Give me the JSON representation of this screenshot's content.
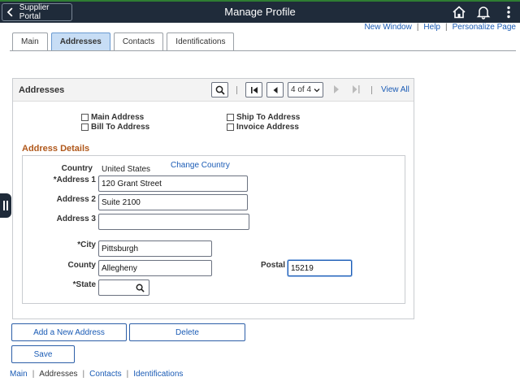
{
  "header": {
    "back_label": "Supplier Portal",
    "title": "Manage Profile",
    "icons": [
      "home-icon",
      "bell-icon",
      "more-vertical-icon"
    ]
  },
  "toplinks": {
    "new_window": "New Window",
    "help": "Help",
    "personalize": "Personalize Page",
    "separator": "|"
  },
  "tabs": [
    {
      "label": "Main",
      "active": false
    },
    {
      "label": "Addresses",
      "active": true
    },
    {
      "label": "Contacts",
      "active": false
    },
    {
      "label": "Identifications",
      "active": false
    }
  ],
  "panel": {
    "title": "Addresses",
    "row_selector": "4 of 4",
    "view_all": "View All"
  },
  "address_types": {
    "main": "Main Address",
    "bill_to": "Bill To Address",
    "ship_to": "Ship To Address",
    "invoice": "Invoice Address"
  },
  "details": {
    "title": "Address Details",
    "country_label": "Country",
    "country_value": "United States",
    "change_country": "Change Country",
    "address1_label": "Address 1",
    "address1_value": "120 Grant Street",
    "address2_label": "Address 2",
    "address2_value": "Suite 2100",
    "address3_label": "Address 3",
    "address3_value": "",
    "city_label": "City",
    "city_value": "Pittsburgh",
    "county_label": "County",
    "county_value": "Allegheny",
    "postal_label": "Postal",
    "postal_value": "15219",
    "state_label": "State",
    "state_value": "",
    "required_marker": "*"
  },
  "buttons": {
    "add_address": "Add a New Address",
    "delete": "Delete",
    "save": "Save"
  },
  "footer": {
    "main": "Main",
    "addresses": "Addresses",
    "contacts": "Contacts",
    "identifications": "Identifications",
    "separator": "|"
  },
  "colors": {
    "header_bg": "#1f2b3a",
    "accent_green": "#2e7d32",
    "link": "#1a5bb5",
    "active_tab": "#c7ddf5",
    "section_title": "#b0581b"
  }
}
